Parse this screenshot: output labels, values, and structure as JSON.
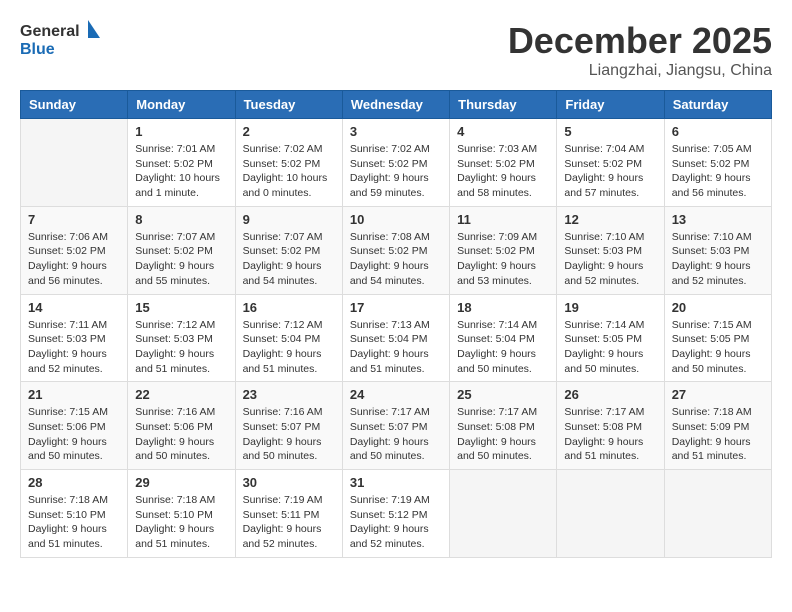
{
  "logo": {
    "line1": "General",
    "line2": "Blue"
  },
  "title": "December 2025",
  "location": "Liangzhai, Jiangsu, China",
  "weekdays": [
    "Sunday",
    "Monday",
    "Tuesday",
    "Wednesday",
    "Thursday",
    "Friday",
    "Saturday"
  ],
  "weeks": [
    [
      {
        "day": "",
        "info": ""
      },
      {
        "day": "1",
        "info": "Sunrise: 7:01 AM\nSunset: 5:02 PM\nDaylight: 10 hours\nand 1 minute."
      },
      {
        "day": "2",
        "info": "Sunrise: 7:02 AM\nSunset: 5:02 PM\nDaylight: 10 hours\nand 0 minutes."
      },
      {
        "day": "3",
        "info": "Sunrise: 7:02 AM\nSunset: 5:02 PM\nDaylight: 9 hours\nand 59 minutes."
      },
      {
        "day": "4",
        "info": "Sunrise: 7:03 AM\nSunset: 5:02 PM\nDaylight: 9 hours\nand 58 minutes."
      },
      {
        "day": "5",
        "info": "Sunrise: 7:04 AM\nSunset: 5:02 PM\nDaylight: 9 hours\nand 57 minutes."
      },
      {
        "day": "6",
        "info": "Sunrise: 7:05 AM\nSunset: 5:02 PM\nDaylight: 9 hours\nand 56 minutes."
      }
    ],
    [
      {
        "day": "7",
        "info": "Sunrise: 7:06 AM\nSunset: 5:02 PM\nDaylight: 9 hours\nand 56 minutes."
      },
      {
        "day": "8",
        "info": "Sunrise: 7:07 AM\nSunset: 5:02 PM\nDaylight: 9 hours\nand 55 minutes."
      },
      {
        "day": "9",
        "info": "Sunrise: 7:07 AM\nSunset: 5:02 PM\nDaylight: 9 hours\nand 54 minutes."
      },
      {
        "day": "10",
        "info": "Sunrise: 7:08 AM\nSunset: 5:02 PM\nDaylight: 9 hours\nand 54 minutes."
      },
      {
        "day": "11",
        "info": "Sunrise: 7:09 AM\nSunset: 5:02 PM\nDaylight: 9 hours\nand 53 minutes."
      },
      {
        "day": "12",
        "info": "Sunrise: 7:10 AM\nSunset: 5:03 PM\nDaylight: 9 hours\nand 52 minutes."
      },
      {
        "day": "13",
        "info": "Sunrise: 7:10 AM\nSunset: 5:03 PM\nDaylight: 9 hours\nand 52 minutes."
      }
    ],
    [
      {
        "day": "14",
        "info": "Sunrise: 7:11 AM\nSunset: 5:03 PM\nDaylight: 9 hours\nand 52 minutes."
      },
      {
        "day": "15",
        "info": "Sunrise: 7:12 AM\nSunset: 5:03 PM\nDaylight: 9 hours\nand 51 minutes."
      },
      {
        "day": "16",
        "info": "Sunrise: 7:12 AM\nSunset: 5:04 PM\nDaylight: 9 hours\nand 51 minutes."
      },
      {
        "day": "17",
        "info": "Sunrise: 7:13 AM\nSunset: 5:04 PM\nDaylight: 9 hours\nand 51 minutes."
      },
      {
        "day": "18",
        "info": "Sunrise: 7:14 AM\nSunset: 5:04 PM\nDaylight: 9 hours\nand 50 minutes."
      },
      {
        "day": "19",
        "info": "Sunrise: 7:14 AM\nSunset: 5:05 PM\nDaylight: 9 hours\nand 50 minutes."
      },
      {
        "day": "20",
        "info": "Sunrise: 7:15 AM\nSunset: 5:05 PM\nDaylight: 9 hours\nand 50 minutes."
      }
    ],
    [
      {
        "day": "21",
        "info": "Sunrise: 7:15 AM\nSunset: 5:06 PM\nDaylight: 9 hours\nand 50 minutes."
      },
      {
        "day": "22",
        "info": "Sunrise: 7:16 AM\nSunset: 5:06 PM\nDaylight: 9 hours\nand 50 minutes."
      },
      {
        "day": "23",
        "info": "Sunrise: 7:16 AM\nSunset: 5:07 PM\nDaylight: 9 hours\nand 50 minutes."
      },
      {
        "day": "24",
        "info": "Sunrise: 7:17 AM\nSunset: 5:07 PM\nDaylight: 9 hours\nand 50 minutes."
      },
      {
        "day": "25",
        "info": "Sunrise: 7:17 AM\nSunset: 5:08 PM\nDaylight: 9 hours\nand 50 minutes."
      },
      {
        "day": "26",
        "info": "Sunrise: 7:17 AM\nSunset: 5:08 PM\nDaylight: 9 hours\nand 51 minutes."
      },
      {
        "day": "27",
        "info": "Sunrise: 7:18 AM\nSunset: 5:09 PM\nDaylight: 9 hours\nand 51 minutes."
      }
    ],
    [
      {
        "day": "28",
        "info": "Sunrise: 7:18 AM\nSunset: 5:10 PM\nDaylight: 9 hours\nand 51 minutes."
      },
      {
        "day": "29",
        "info": "Sunrise: 7:18 AM\nSunset: 5:10 PM\nDaylight: 9 hours\nand 51 minutes."
      },
      {
        "day": "30",
        "info": "Sunrise: 7:19 AM\nSunset: 5:11 PM\nDaylight: 9 hours\nand 52 minutes."
      },
      {
        "day": "31",
        "info": "Sunrise: 7:19 AM\nSunset: 5:12 PM\nDaylight: 9 hours\nand 52 minutes."
      },
      {
        "day": "",
        "info": ""
      },
      {
        "day": "",
        "info": ""
      },
      {
        "day": "",
        "info": ""
      }
    ]
  ]
}
